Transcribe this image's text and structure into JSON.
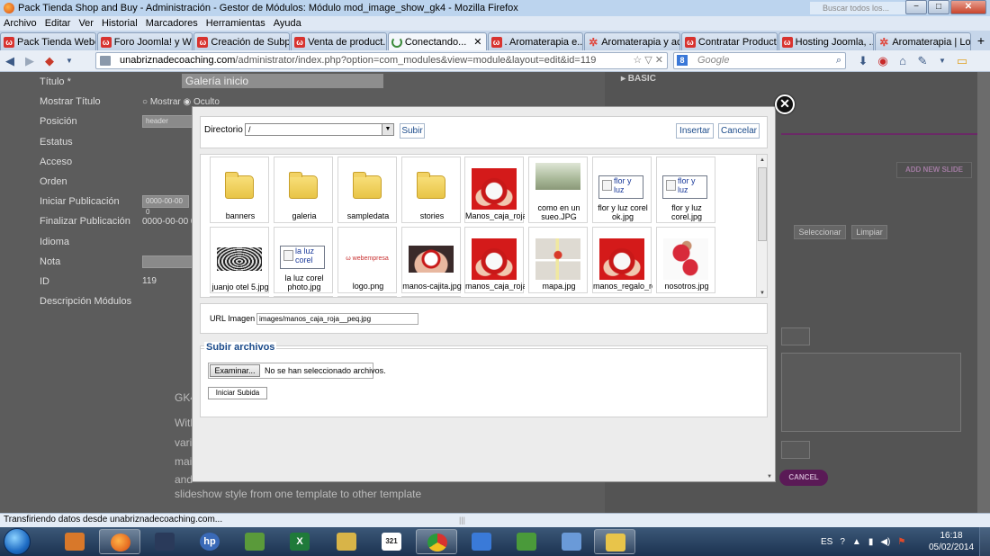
{
  "window": {
    "title": "Pack Tienda Shop and Buy - Administración - Gestor de Módulos: Módulo mod_image_show_gk4 - Mozilla Firefox",
    "search_placeholder": "Buscar todos los...",
    "minimize": "−",
    "maximize": "□",
    "close": "✕"
  },
  "menu": [
    "Archivo",
    "Editar",
    "Ver",
    "Historial",
    "Marcadores",
    "Herramientas",
    "Ayuda"
  ],
  "tabs": [
    {
      "label": "Pack Tienda Webe...",
      "icon": "w",
      "active": false
    },
    {
      "label": "Foro Joomla! y W...",
      "icon": "w",
      "active": false
    },
    {
      "label": "Creación de Subpr...",
      "icon": "w",
      "active": false
    },
    {
      "label": "Venta de product...",
      "icon": "w",
      "active": false
    },
    {
      "label": "Conectando...",
      "icon": "spin",
      "active": true
    },
    {
      "label": ". Aromaterapia e...",
      "icon": "w",
      "active": false
    },
    {
      "label": "Aromaterapia y ac...",
      "icon": "star",
      "active": false
    },
    {
      "label": "Contratar Product...",
      "icon": "w",
      "active": false
    },
    {
      "label": "Hosting Joomla, ...",
      "icon": "w",
      "active": false
    },
    {
      "label": "Aromaterapia | Lo...",
      "icon": "star",
      "active": false
    }
  ],
  "tab_close": "✕",
  "new_tab": "+",
  "nav": {
    "url_host": "unabriznadecoaching.com",
    "url_path": "/administrator/index.php?option=com_modules&view=module&layout=edit&id=119",
    "search_engine_placeholder": "Google",
    "back": "◀",
    "forward": "▶",
    "url_icons": "☆ ▽ ✕"
  },
  "background_form": {
    "title_label": "Título *",
    "title_value": "Galería inicio",
    "rows": [
      {
        "label": "Mostrar Título",
        "value": "○ Mostrar    ◉ Oculto"
      },
      {
        "label": "Posición",
        "value": "header"
      },
      {
        "label": "Estatus",
        "value": ""
      },
      {
        "label": "Acceso",
        "value": ""
      },
      {
        "label": "Orden",
        "value": ""
      },
      {
        "label": "Iniciar Publicación",
        "value": "0000-00-00 0"
      },
      {
        "label": "Finalizar Publicación",
        "value": "0000-00-00 0"
      },
      {
        "label": "Idioma",
        "value": ""
      },
      {
        "label": "Nota",
        "value": ""
      },
      {
        "label": "ID",
        "value": "119"
      },
      {
        "label": "Descripción Módulos",
        "value": ""
      }
    ],
    "text_lines": [
      "GK4",
      "With",
      "vari",
      "mai",
      "and",
      "slideshow style from one template to other template"
    ]
  },
  "background_right": {
    "basic": "▸ BASIC",
    "add_slide": "ADD NEW SLIDE",
    "select_btn": "Seleccionar",
    "clear_btn": "Limpiar",
    "cancel": "CANCEL"
  },
  "modal": {
    "close": "✕",
    "directory_label": "Directorio",
    "directory_value": "/",
    "up_button": "Subir",
    "insert_button": "Insertar",
    "cancel_button": "Cancelar",
    "files": [
      {
        "name": "banners",
        "type": "folder"
      },
      {
        "name": "galeria",
        "type": "folder"
      },
      {
        "name": "sampledata",
        "type": "folder"
      },
      {
        "name": "stories",
        "type": "folder"
      },
      {
        "name": "Manos_caja_roja",
        "type": "image-red-hands"
      },
      {
        "name": "como en un sueo.JPG",
        "type": "image-forest"
      },
      {
        "name": "flor y luz corel ok.jpg",
        "type": "broken",
        "alt": "flor y luz"
      },
      {
        "name": "flor y luz corel.jpg",
        "type": "broken",
        "alt": "flor y luz"
      },
      {
        "name": "juanjo otel 5.jpg",
        "type": "image-spiral"
      },
      {
        "name": "la luz corel photo.jpg",
        "type": "broken",
        "alt": "la luz corel"
      },
      {
        "name": "logo.png",
        "type": "image-logo",
        "alt": "webempresa"
      },
      {
        "name": "manos-cajita.jpg",
        "type": "image-gift"
      },
      {
        "name": "manos_caja_roja",
        "type": "image-red-hands"
      },
      {
        "name": "mapa.jpg",
        "type": "image-map"
      },
      {
        "name": "manos_regalo_ro",
        "type": "image-red-hands"
      },
      {
        "name": "nosotros.jpg",
        "type": "image-yoga"
      }
    ],
    "url_label": "URL Imagen",
    "url_value": "images/manos_caja_roja__peq.jpg",
    "upload_legend": "Subir archivos",
    "browse_button": "Examinar...",
    "file_status": "No se han seleccionado archivos.",
    "start_upload": "Iniciar Subida"
  },
  "status_bar": "Transfiriendo datos desde unabriznadecoaching.com...",
  "taskbar": {
    "apps": [
      "media-player",
      "firefox",
      "media-center",
      "hp",
      "notes",
      "excel",
      "explorer",
      "calendar",
      "chrome",
      "internet",
      "evernote",
      "window",
      "sticky"
    ],
    "language": "ES",
    "time": "16:18",
    "date": "05/02/2014"
  },
  "colors": {
    "accent_blue": "#1a4a8a",
    "overlay_bg": "#5c5c5c",
    "purple": "#5a1a56"
  }
}
